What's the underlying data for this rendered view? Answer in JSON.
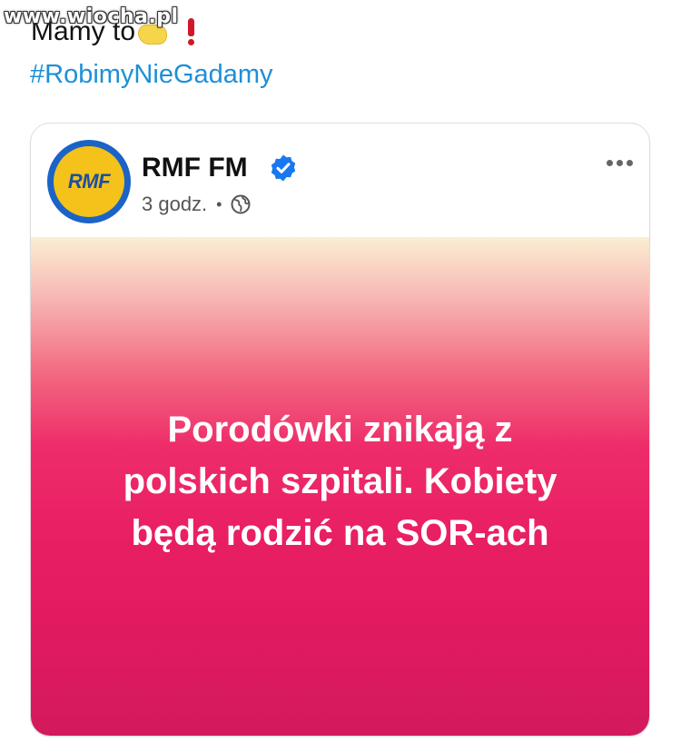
{
  "watermark": "www.wiocha.pl",
  "tweet": {
    "text": "Mamy to",
    "hashtag": "#RobimyNieGadamy"
  },
  "post": {
    "avatar_text": "RMF",
    "page_name": "RMF FM",
    "time": "3 godz.",
    "separator": "•",
    "banner_lines": [
      "Porodówki znikają z",
      "polskich szpitali. Kobiety",
      "będą rodzić na SOR-ach"
    ]
  },
  "icons": [
    "hand-emoji-icon",
    "exclamation-icon",
    "verified-icon",
    "globe-icon",
    "more-options-icon"
  ],
  "colors": {
    "hashtag": "#1d8fd8",
    "verified": "#1877f2",
    "avatar_ring": "#1b63c6",
    "avatar_fill": "#f4c21a",
    "banner_top": "#fbeed3",
    "banner_bottom": "#d11a5c"
  }
}
